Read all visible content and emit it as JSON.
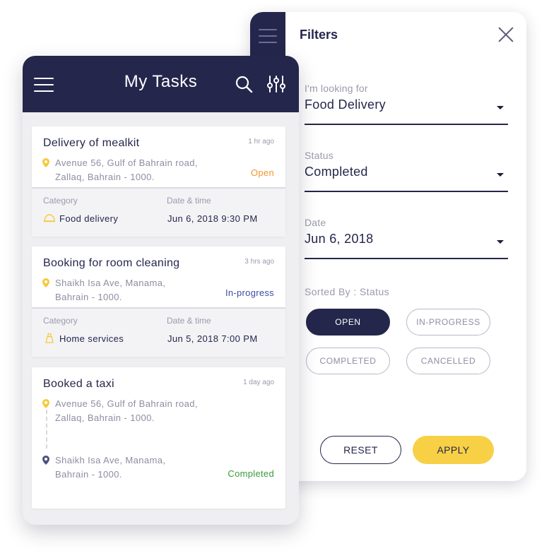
{
  "filters": {
    "title": "Filters",
    "fields": [
      {
        "label": "I'm looking for",
        "value": "Food Delivery"
      },
      {
        "label": "Status",
        "value": "Completed"
      },
      {
        "label": "Date",
        "value": "Jun 6, 2018"
      }
    ],
    "sorted_by_label": "Sorted By : Status",
    "chips": [
      {
        "label": "OPEN",
        "active": true
      },
      {
        "label": "IN-PROGRESS",
        "active": false
      },
      {
        "label": "COMPLETED",
        "active": false
      },
      {
        "label": "CANCELLED",
        "active": false
      }
    ],
    "reset_label": "RESET",
    "apply_label": "APPLY"
  },
  "tasks": {
    "title": "My Tasks",
    "category_label": "Category",
    "datetime_label": "Date & time",
    "cards": [
      {
        "title": "Delivery of  mealkit",
        "time": "1 hr ago",
        "address": [
          "Avenue 56, Gulf of Bahrain road,",
          "Zallaq, Bahrain - 1000."
        ],
        "status": "Open",
        "category": "Food delivery",
        "datetime": "Jun 6, 2018  9:30 PM"
      },
      {
        "title": "Booking for room cleaning",
        "time": "3 hrs ago",
        "address": [
          "Shaikh Isa Ave, Manama,",
          "Bahrain - 1000."
        ],
        "status": "In-progress",
        "category": "Home services",
        "datetime": "Jun 5, 2018  7:00 PM"
      },
      {
        "title": "Booked a taxi",
        "time": "1 day ago",
        "address_from": [
          "Avenue 56, Gulf of Bahrain road,",
          "Zallaq, Bahrain - 1000."
        ],
        "address_to": [
          "Shaikh Isa Ave, Manama,",
          "Bahrain - 1000."
        ],
        "status": "Completed"
      }
    ]
  },
  "colors": {
    "navy": "#25264c",
    "accent_yellow": "#f7d046",
    "status_open": "#f0962e",
    "status_inprogress": "#3d4aa6",
    "status_completed": "#3a9a3a"
  },
  "icons": [
    "menu-icon",
    "search-icon",
    "sliders-icon",
    "close-icon",
    "location-pin-icon",
    "food-cloche-icon",
    "cleaning-icon",
    "chevron-down-icon"
  ]
}
